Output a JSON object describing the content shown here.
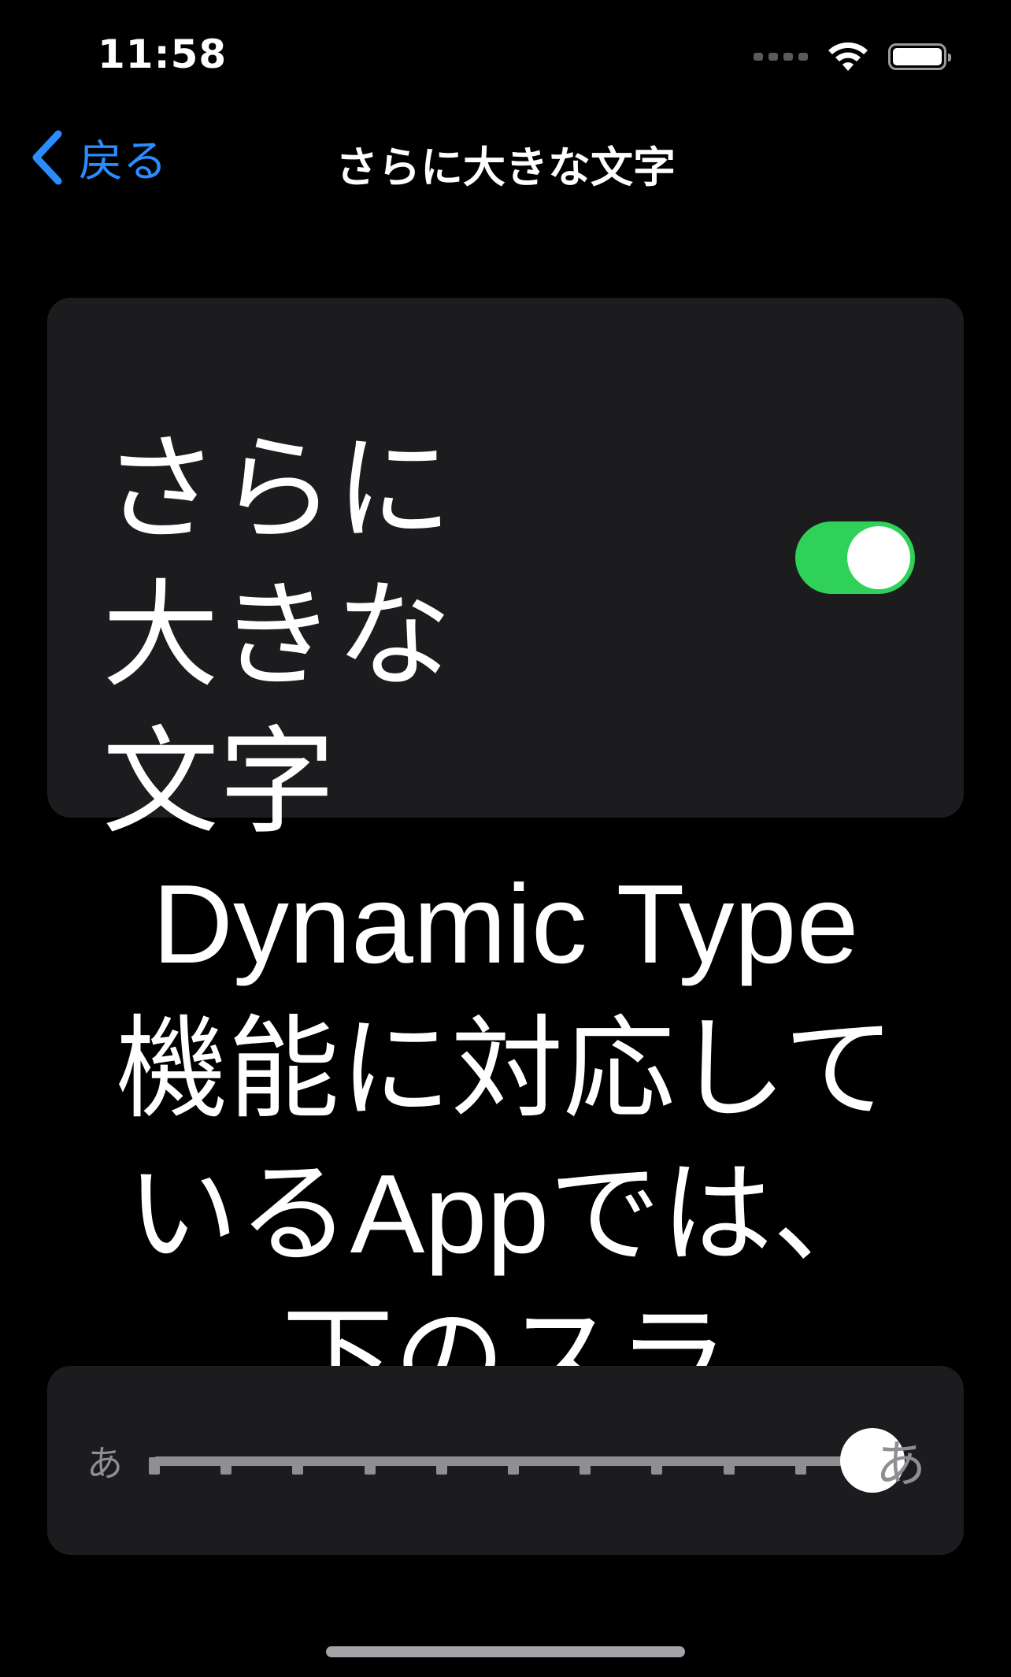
{
  "status_bar": {
    "time": "11:58",
    "wifi_icon": "wifi-icon",
    "battery_icon": "battery-icon"
  },
  "nav": {
    "back_label": "戻る",
    "title": "さらに大きな文字",
    "back_icon": "chevron-left-icon"
  },
  "larger_text": {
    "label": "さらに大きな文字",
    "enabled": true
  },
  "description": "Dynamic Type機能に対応しているAppでは、下のスラ",
  "slider": {
    "small_label": "あ",
    "large_label": "あ",
    "steps": 11,
    "value_fraction": 1.0
  },
  "colors": {
    "accent": "#2a8cff",
    "switch_on": "#30d158",
    "card_bg": "#1c1c1e",
    "background": "#000000"
  }
}
